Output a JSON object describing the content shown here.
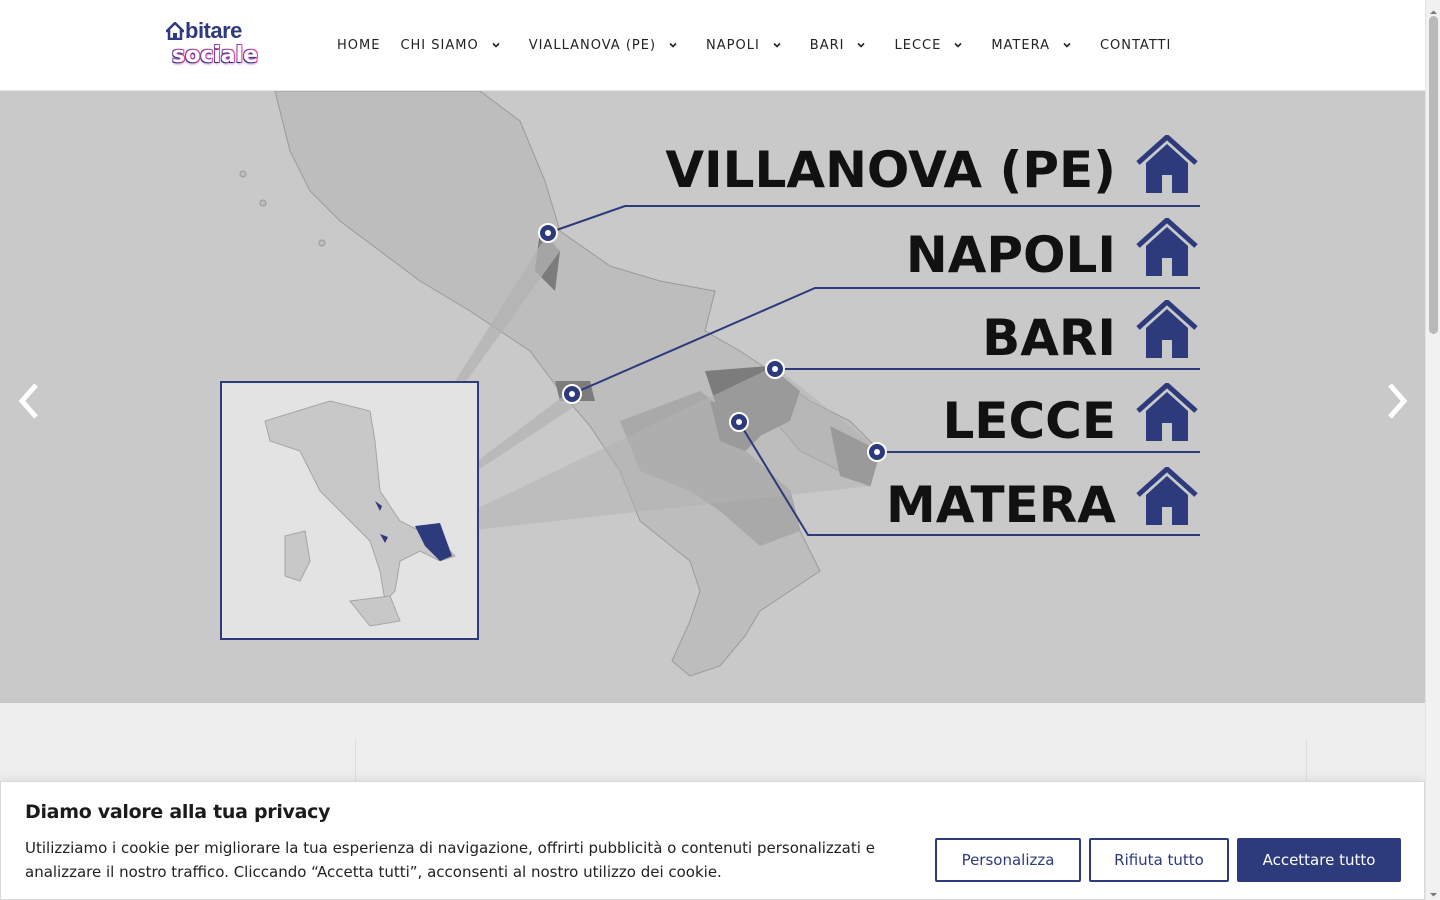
{
  "header": {
    "logo_top": "bitare",
    "logo_bottom": "sociale",
    "nav": [
      {
        "label": "HOME",
        "has_dropdown": false
      },
      {
        "label": "CHI SIAMO",
        "has_dropdown": true
      },
      {
        "label": "VIALLANOVA (PE)",
        "has_dropdown": true
      },
      {
        "label": "NAPOLI",
        "has_dropdown": true
      },
      {
        "label": "BARI",
        "has_dropdown": true
      },
      {
        "label": "LECCE",
        "has_dropdown": true
      },
      {
        "label": "MATERA",
        "has_dropdown": true
      },
      {
        "label": "CONTATTI",
        "has_dropdown": false
      }
    ]
  },
  "hero": {
    "cities": [
      "VILLANOVA (PE)",
      "NAPOLI",
      "BARI",
      "LECCE",
      "MATERA"
    ],
    "prev_icon": "chevron-left-icon",
    "next_icon": "chevron-right-icon"
  },
  "cookie": {
    "title": "Diamo valore alla tua privacy",
    "text": "Utilizziamo i cookie per migliorare la tua esperienza di navigazione, offrirti pubblicità o contenuti personalizzati e analizzare il nostro traffico. Cliccando “Accetta tutti”, acconsenti al nostro utilizzo dei cookie.",
    "customize_label": "Personalizza",
    "reject_label": "Rifiuta tutto",
    "accept_label": "Accettare tutto"
  },
  "colors": {
    "brand": "#2d3a7c",
    "hero_bg": "#c9c9c9",
    "section_bg": "#eeeeee"
  }
}
